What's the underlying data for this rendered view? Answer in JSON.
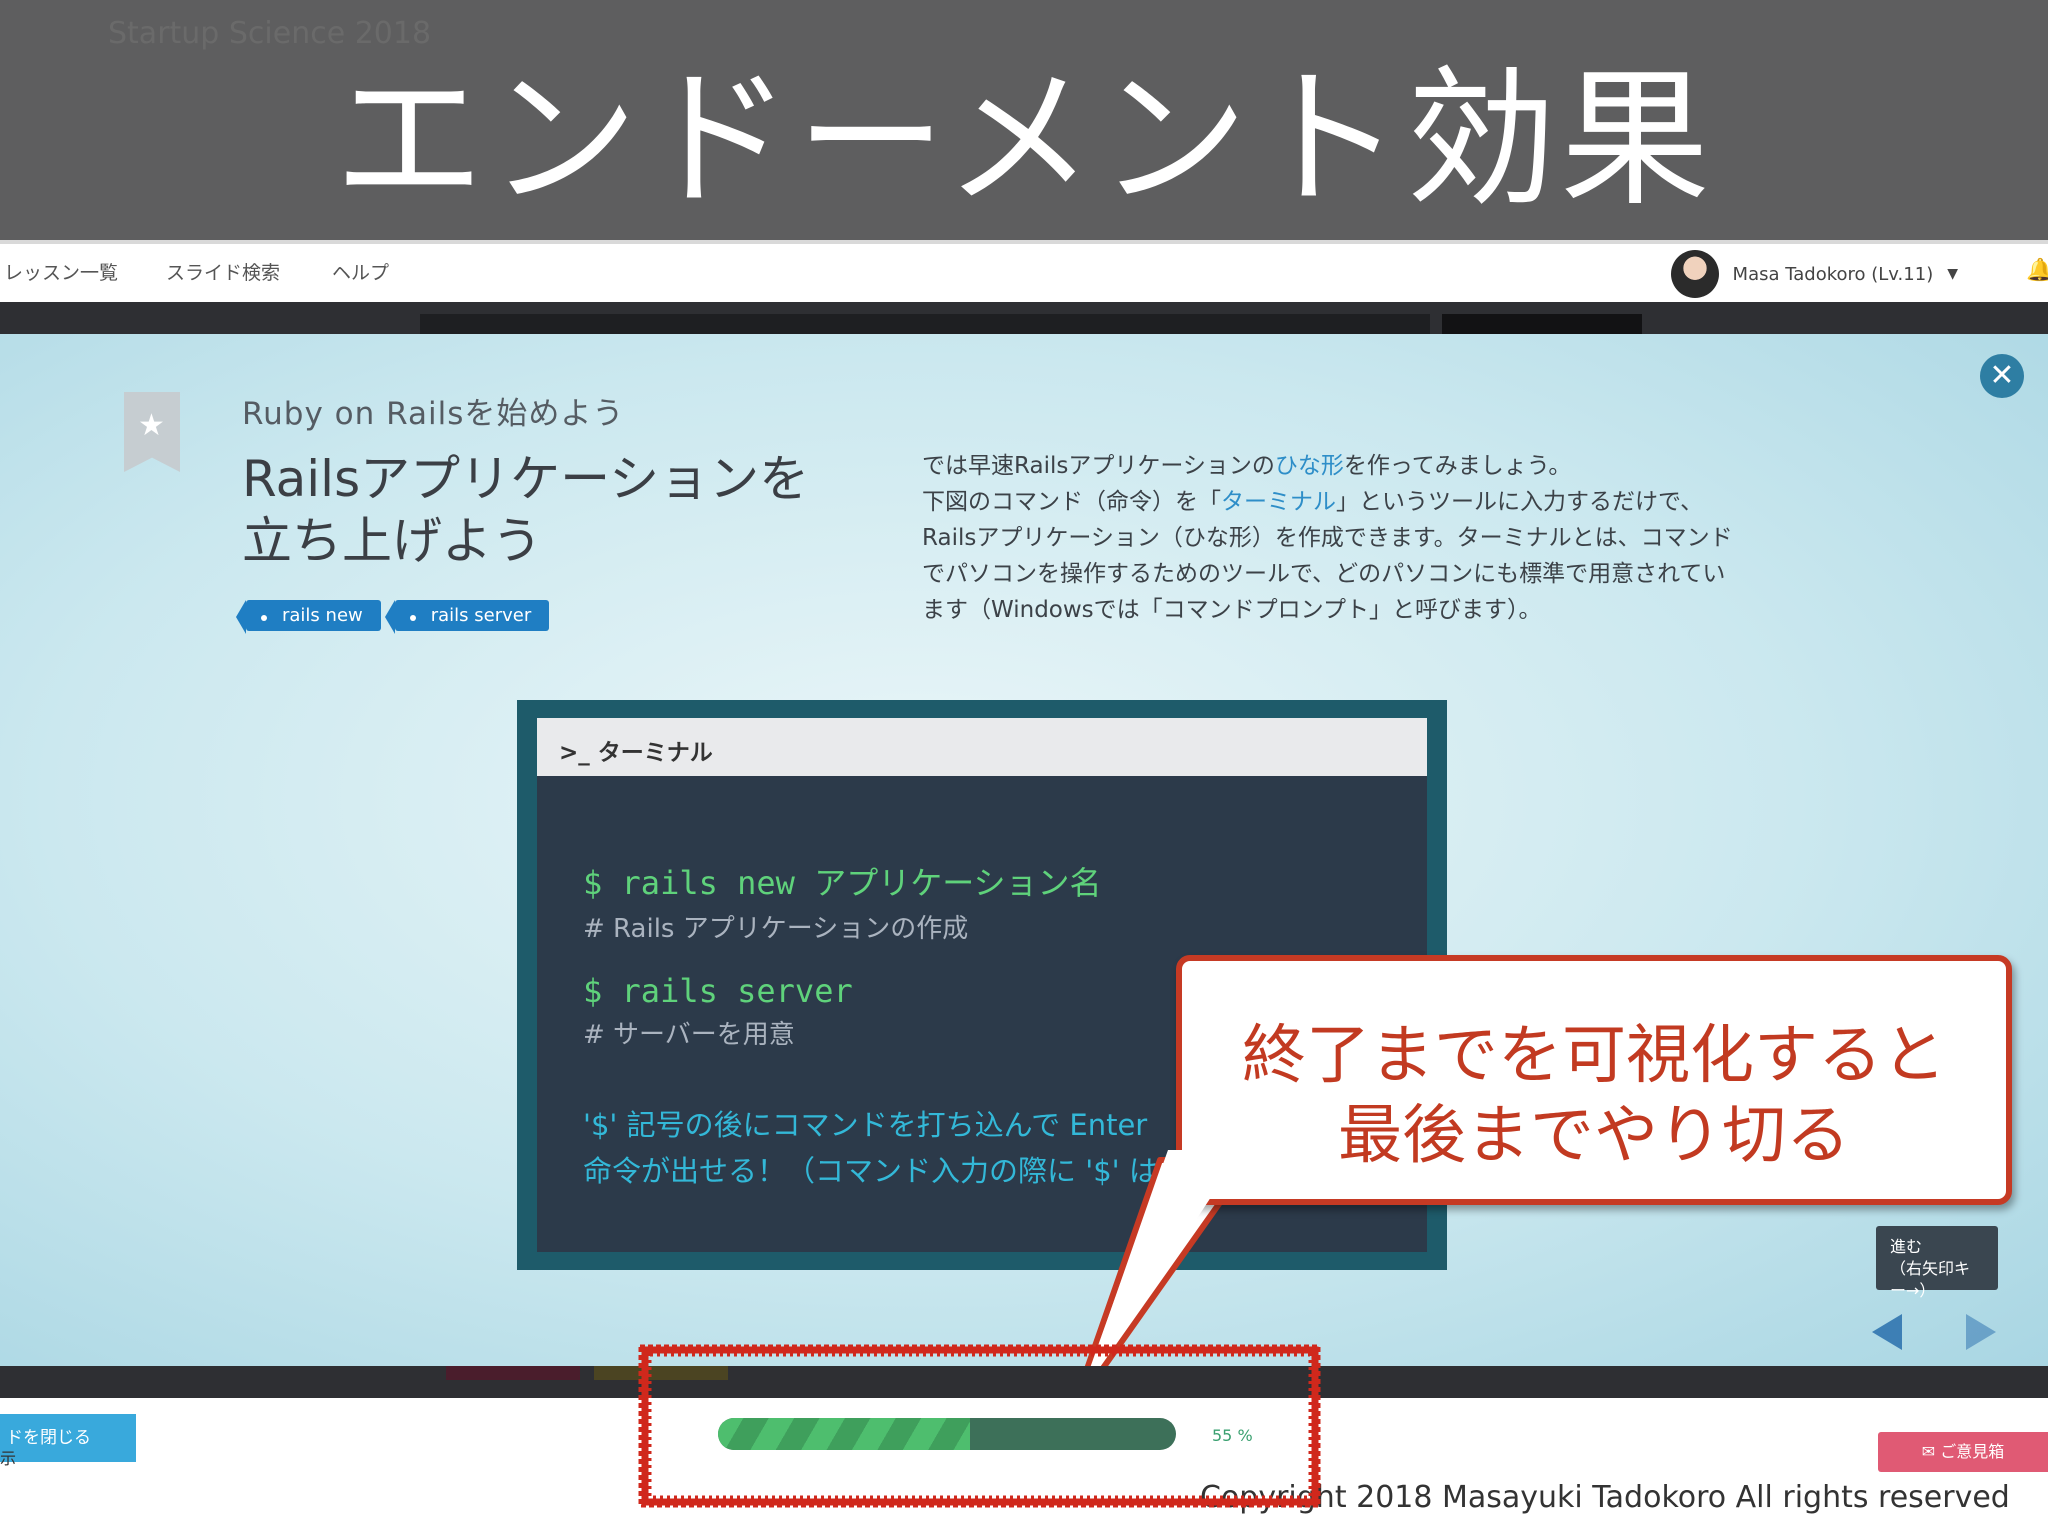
{
  "header": {
    "tag": "Startup Science 2018",
    "title": "エンドーメント効果"
  },
  "nav": {
    "items": [
      "レッスン一覧",
      "スライド検索",
      "ヘルプ"
    ],
    "user": "Masa Tadokoro (Lv.11)"
  },
  "lesson": {
    "course": "Ruby on Railsを始めよう",
    "title_line1": "Railsアプリケーションを",
    "title_line2": "立ち上げよう",
    "tags": [
      "rails new",
      "rails server"
    ],
    "desc_line1_a": "では早速Railsアプリケーションの",
    "desc_line1_link": "ひな形",
    "desc_line1_b": "を作ってみましょう。",
    "desc_line2_a": "下図のコマンド（命令）を「",
    "desc_line2_link": "ターミナル",
    "desc_line2_b": "」というツールに入力するだけで、",
    "desc_line3": "Railsアプリケーション（ひな形）を作成できます。ターミナルとは、コマンド",
    "desc_line4": "でパソコンを操作するためのツールで、どのパソコンにも標準で用意されてい",
    "desc_line5": "ます（Windowsでは「コマンドプロンプト」と呼びます）。"
  },
  "terminal": {
    "title": ">_ ターミナル",
    "cmd1": "$ rails new アプリケーション名",
    "cmt1": "# Rails アプリケーションの作成",
    "cmd2": "$ rails server",
    "cmt2": "# サーバーを用意",
    "note1": "'$' 記号の後にコマンドを打ち込んで Enter",
    "note2": "命令が出せる！（コマンド入力の際に '$' は"
  },
  "callout": {
    "line1": "終了までを可視化すると",
    "line2": "最後までやり切る"
  },
  "nav_controls": {
    "next_label": "進む",
    "next_hint": "（右矢印キー→）"
  },
  "bottom": {
    "close_label": "ドを閉じる",
    "close_sub": "示",
    "progress_percent": 55,
    "progress_text": "55 %",
    "feedback": "✉ ご意見箱"
  },
  "footer": {
    "copyright": "Copyright 2018 Masayuki Tadokoro All rights reserved"
  },
  "colors": {
    "header_band": "#5e5e5f",
    "accent_blue": "#1f7ec3",
    "callout_red": "#c63a24",
    "progress_green": "#4ebe6e"
  }
}
